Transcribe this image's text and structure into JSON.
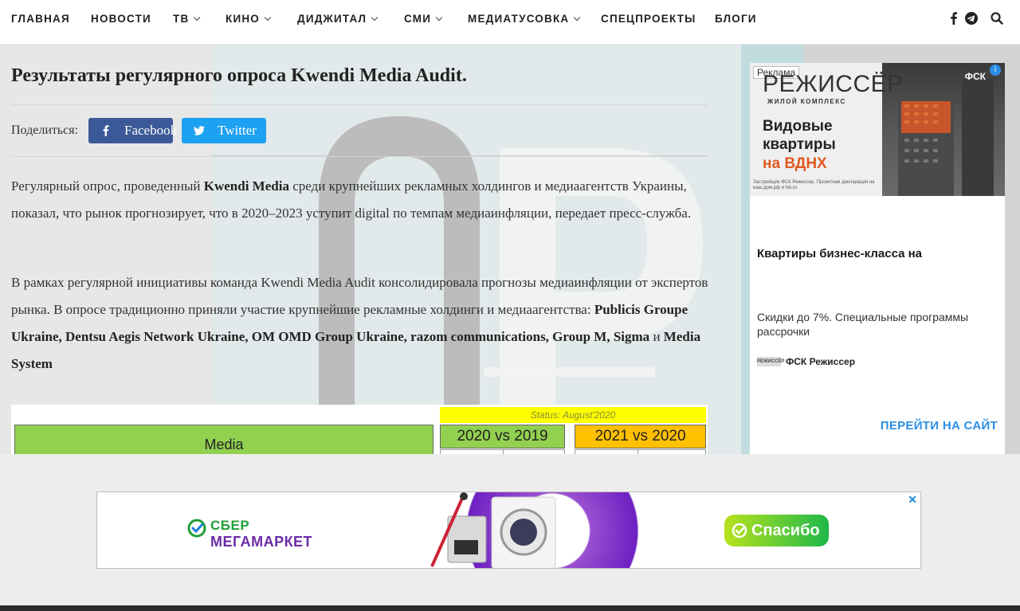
{
  "nav": {
    "items": [
      {
        "label": "ГЛАВНАЯ",
        "dropdown": false
      },
      {
        "label": "НОВОСТИ",
        "dropdown": false
      },
      {
        "label": "ТВ",
        "dropdown": true
      },
      {
        "label": "КИНО",
        "dropdown": true
      },
      {
        "label": "ДИДЖИТАЛ",
        "dropdown": true
      },
      {
        "label": "СМИ",
        "dropdown": true
      },
      {
        "label": "МЕДИАТУСОВКА",
        "dropdown": true
      },
      {
        "label": "СПЕЦПРОЕКТЫ",
        "dropdown": false
      },
      {
        "label": "БЛОГИ",
        "dropdown": false
      }
    ],
    "icons": [
      "facebook-icon",
      "telegram-icon",
      "search-icon"
    ]
  },
  "article": {
    "title": "Результаты регулярного опроса Kwendi Media Audit.",
    "share_label": "Поделиться:",
    "share_facebook": "Facebook",
    "share_twitter": "Twitter",
    "p1_a": "Регулярный опрос, проведенный ",
    "p1_b": "Kwendi Media",
    "p1_c": " среди крупнейших рекламных холдингов и медиаагентств Украины, показал, что рынок прогнозирует, что в 2020–2023 уступит digital по темпам медиаинфляции, передает пресс-служба.",
    "p2_a": " В рамках регулярной инициативы команда Kwendi Media Audit консолидировала прогнозы медиаинфляции от экспертов рынка. В опросе традиционно приняли участие крупнейшие рекламные холдинги и медиаагентства: ",
    "p2_b": "Publicis Groupe Ukraine, Dentsu Aegis Network Ukraine, OM OMD Group Ukraine, razom communications, Group M, Sigma",
    "p2_c": " и ",
    "p2_d": "Media System",
    "table": {
      "media_label": "Media",
      "status": "Status: August'2020",
      "col1": "2020 vs 2019",
      "col2": "2021 vs 2020"
    }
  },
  "ad_right": {
    "label": "Реклама",
    "logo": "РЕЖИССЁР",
    "logo_sub": "ЖИЛОЙ КОМПЛЕКС",
    "headline_1": "Видовые",
    "headline_2": "квартиры",
    "headline_red": "на ВДНХ",
    "fine_print": "Застройщик ФСК Режиссер. Проектная декларация на наш.дом.рф и fsk.ru",
    "badge": "ФСК",
    "title": "Квартиры бизнес-класса на",
    "description": "Скидки до 7%. Специальные программы рассрочки",
    "brand": "ФСК Режиссер",
    "brand_mini": "РЕЖИССЁР",
    "cta": "ПЕРЕЙТИ НА САЙТ",
    "accent": "#2b8fe6"
  },
  "ad_bottom": {
    "brand_line1": "СБЕР",
    "brand_line2": "МЕГАМАРКЕТ",
    "promo": "Спасибо",
    "close": "✕"
  }
}
